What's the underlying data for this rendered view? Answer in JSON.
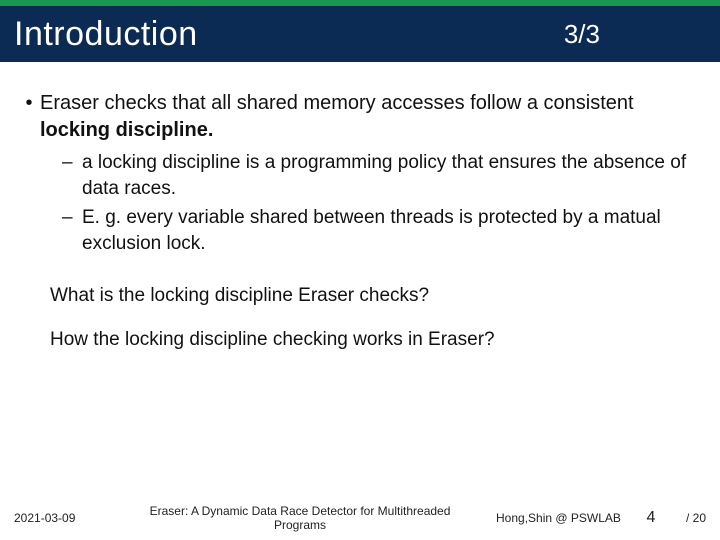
{
  "header": {
    "title": "Introduction",
    "pager": "3/3"
  },
  "main_bullet": {
    "dot": "•",
    "text_before": "Eraser checks that all shared memory accesses follow a consistent  ",
    "text_bold": "locking discipline."
  },
  "sub_bullets": [
    {
      "dash": "–",
      "text": "a locking discipline is a programming policy that ensures the absence of data races."
    },
    {
      "dash": "–",
      "text": "E. g. every variable shared between threads is protected by a matual exclusion lock."
    }
  ],
  "questions": [
    "What is the locking discipline Eraser checks?",
    "How the locking discipline checking works in Eraser?"
  ],
  "footer": {
    "date": "2021-03-09",
    "title_line1": "Eraser: A Dynamic Data Race Detector for Multithreaded",
    "title_line2": "Programs",
    "author": "Hong,Shin @ PSWLAB",
    "page": "4",
    "total": "/ 20"
  }
}
